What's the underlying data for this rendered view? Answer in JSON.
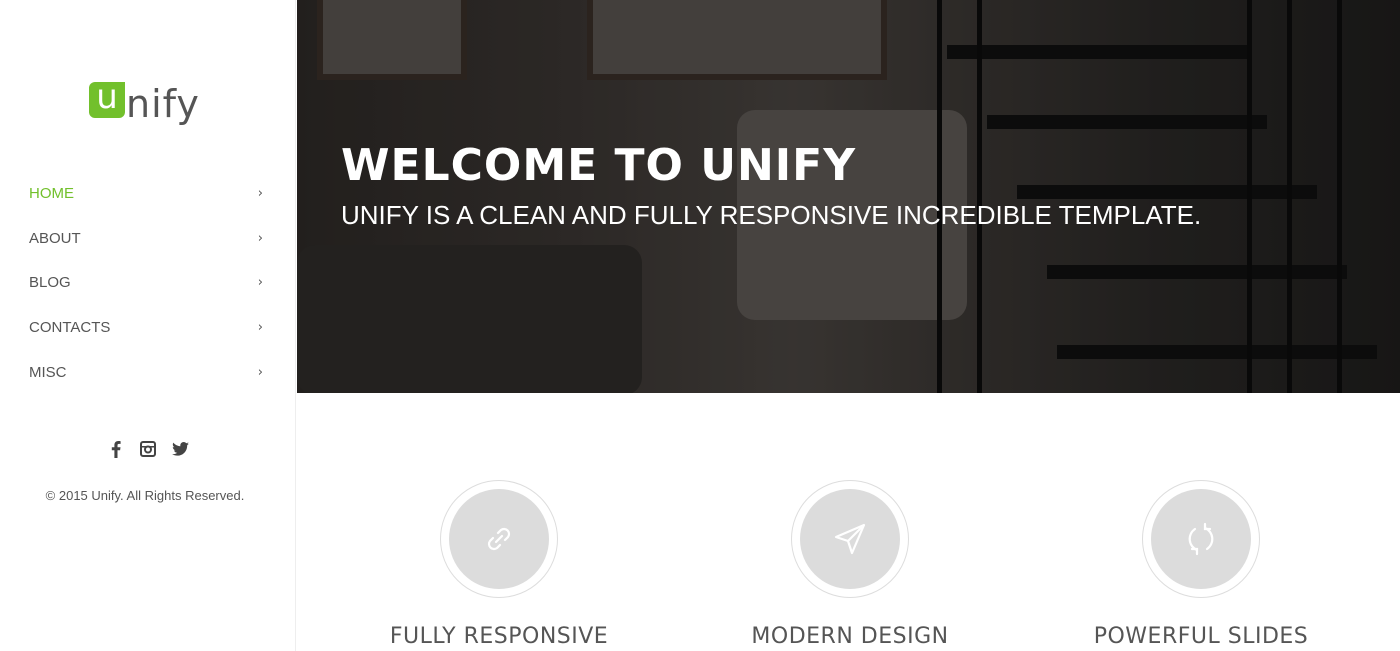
{
  "logo": {
    "initial": "u",
    "rest": "nify"
  },
  "nav": [
    {
      "label": "HOME"
    },
    {
      "label": "ABOUT"
    },
    {
      "label": "BLOG"
    },
    {
      "label": "CONTACTS"
    },
    {
      "label": "MISC"
    }
  ],
  "social": [
    "facebook-icon",
    "instagram-icon",
    "twitter-icon"
  ],
  "copyright": "© 2015 Unify. All Rights Reserved.",
  "hero": {
    "title": "WELCOME TO UNIFY",
    "subtitle": "UNIFY IS A CLEAN AND FULLY RESPONSIVE INCREDIBLE TEMPLATE."
  },
  "features": [
    {
      "title": "FULLY RESPONSIVE",
      "icon": "link-icon"
    },
    {
      "title": "MODERN DESIGN",
      "icon": "paper-plane-icon"
    },
    {
      "title": "POWERFUL SLIDES",
      "icon": "refresh-icon"
    }
  ],
  "colors": {
    "accent": "#72c02c",
    "text": "#555555",
    "circle": "#dcdcdc"
  }
}
